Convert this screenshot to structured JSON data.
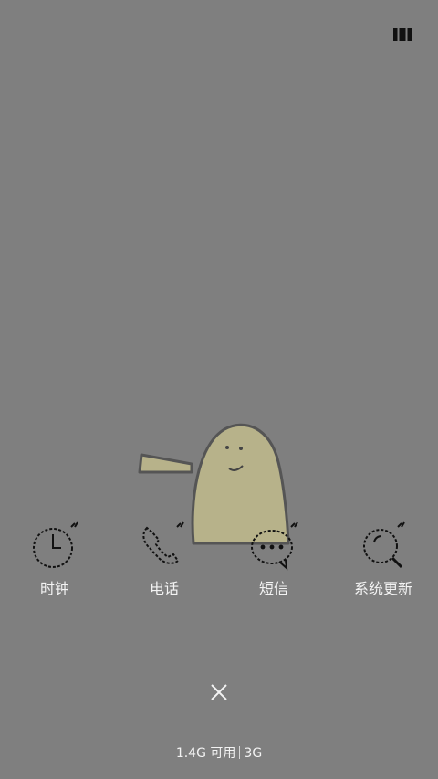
{
  "top_right_icon": "grid-view-icon",
  "dock": {
    "items": [
      {
        "label": "时钟",
        "icon": "clock-icon"
      },
      {
        "label": "电话",
        "icon": "phone-icon"
      },
      {
        "label": "短信",
        "icon": "message-icon"
      },
      {
        "label": "系统更新",
        "icon": "update-search-icon"
      }
    ]
  },
  "close_icon": "close-icon",
  "status": {
    "memory": "1.4G 可用",
    "network": "3G"
  },
  "colors": {
    "background": "#7f7f7f",
    "mascot_fill": "#b7b28a",
    "text": "#f3f3f3"
  }
}
